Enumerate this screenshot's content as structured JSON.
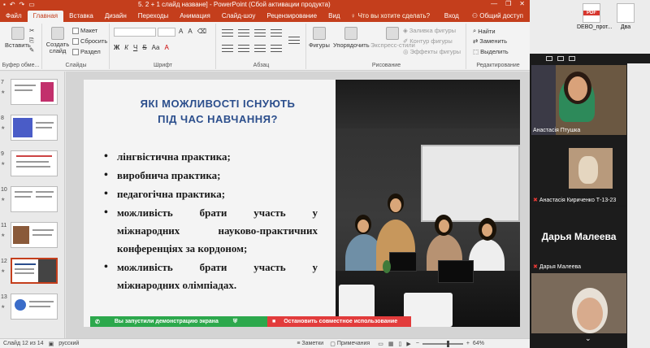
{
  "window": {
    "title": "5. 2 + 1 слайд назване] - PowerPoint (Сбой активации продукта)",
    "controls": [
      "—",
      "❐",
      "✕"
    ]
  },
  "tabs": [
    {
      "label": "Файл",
      "active": false
    },
    {
      "label": "Главная",
      "active": true
    },
    {
      "label": "Вставка",
      "active": false
    },
    {
      "label": "Дизайн",
      "active": false
    },
    {
      "label": "Переходы",
      "active": false
    },
    {
      "label": "Анимация",
      "active": false
    },
    {
      "label": "Слайд-шоу",
      "active": false
    },
    {
      "label": "Рецензирование",
      "active": false
    },
    {
      "label": "Вид",
      "active": false
    }
  ],
  "tell_me": "Что вы хотите сделать?",
  "sign_in": "Вход",
  "share": "Общий доступ",
  "ribbon": {
    "clipboard": {
      "label": "Буфер обме...",
      "paste": "Вставить"
    },
    "slides": {
      "label": "Слайды",
      "new_slide": "Создать слайд",
      "layout": "Макет",
      "reset": "Сбросить",
      "section": "Раздел"
    },
    "font": {
      "label": "Шрифт",
      "bold": "Ж",
      "italic": "К",
      "underline": "Ч",
      "strike": "S",
      "font_up": "A",
      "font_down": "A",
      "case": "Aa"
    },
    "paragraph": {
      "label": "Абзац"
    },
    "drawing": {
      "label": "Рисование",
      "shapes": "Фигуры",
      "arrange": "Упорядочить",
      "quick_styles": "Экспресс-стили",
      "fill": "Заливка фигуры",
      "outline": "Контур фигуры",
      "effects": "Эффекты фигуры"
    },
    "editing": {
      "label": "Редактирование",
      "find": "Найти",
      "replace": "Заменить",
      "select": "Выделить"
    }
  },
  "thumbnails": [
    {
      "num": "7",
      "selected": false
    },
    {
      "num": "8",
      "selected": false
    },
    {
      "num": "9",
      "selected": false
    },
    {
      "num": "10",
      "selected": false
    },
    {
      "num": "11",
      "selected": false
    },
    {
      "num": "12",
      "selected": true
    },
    {
      "num": "13",
      "selected": false
    }
  ],
  "slide": {
    "title_line1": "ЯКІ МОЖЛИВОСТІ ІСНУЮТЬ",
    "title_line2": "ПІД ЧАС НАВЧАННЯ?",
    "bullets": [
      "лінгвістична практика;",
      "виробнича практика;",
      "педагогічна практика;"
    ],
    "bullet4": [
      "можливість брати участь у",
      "міжнародних науково-практичних",
      "конференціях за кордоном;"
    ],
    "bullet5": [
      "можливість брати участь у",
      "міжнародних олімпіадах."
    ]
  },
  "share_bar": {
    "started": "Вы запустили демонстрацию экрана",
    "stop": "Остановить совместное использование"
  },
  "status": {
    "slide": "Слайд 12 из 14",
    "language": "русский",
    "notes": "Заметки",
    "comments": "Примечания",
    "zoom": "64%"
  },
  "desktop_icons": [
    {
      "label": "DEBO_прот...",
      "type": "pdf"
    },
    {
      "label": "Два",
      "type": "doc"
    }
  ],
  "participants": [
    {
      "name": "Анастасія Птушка",
      "muted": false
    },
    {
      "name": "Анастасія Кириченко Т-13-23",
      "muted": true
    },
    {
      "name": "Дарья Малеева",
      "muted": true,
      "display_name": "Дарья Малеева"
    },
    {
      "name": "",
      "muted": false
    }
  ]
}
